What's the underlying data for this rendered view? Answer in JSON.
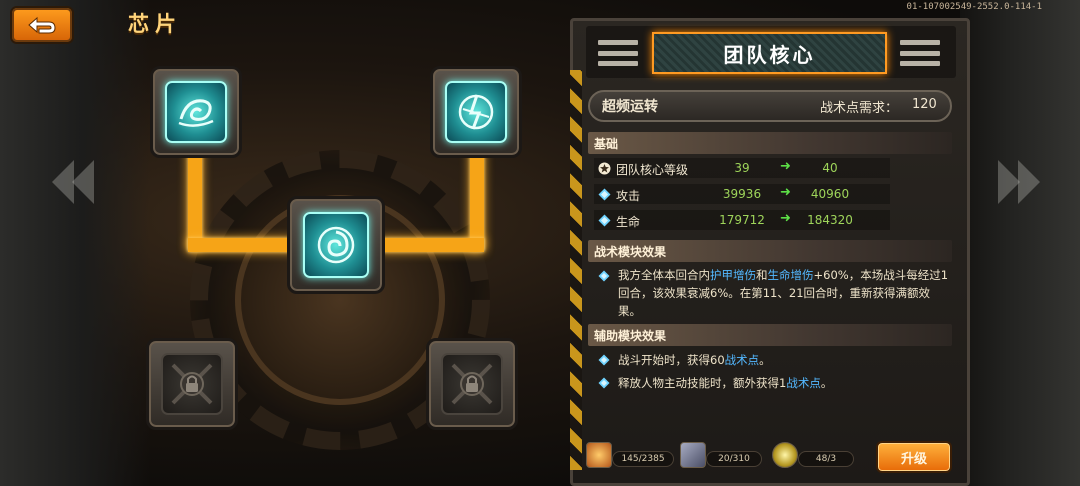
{
  "top_bar": {
    "title": "芯片",
    "build_id": "01-107002549-2552.0-114-1",
    "back_icon": "back-arrow-icon"
  },
  "chip_tree": {
    "top_left": {
      "state": "active",
      "icon": "swirl-emblem-icon"
    },
    "top_right": {
      "state": "active",
      "icon": "lightning-figure-icon"
    },
    "center": {
      "state": "active",
      "icon": "vortex-core-icon"
    },
    "bottom_left": {
      "state": "locked",
      "icon": "lock-icon"
    },
    "bottom_right": {
      "state": "locked",
      "icon": "lock-icon"
    },
    "wire_color": "#f6a417"
  },
  "panel": {
    "title": "团队核心",
    "skill": {
      "name": "超频运转",
      "cost_label": "战术点需求：",
      "cost": "120"
    },
    "basic_section": {
      "heading": "基础",
      "stats": [
        {
          "icon": "star-icon",
          "label": "团队核心等级",
          "old": "39",
          "new": "40"
        },
        {
          "icon": "diamond-icon",
          "label": "攻击",
          "old": "39936",
          "new": "40960"
        },
        {
          "icon": "diamond-icon",
          "label": "生命",
          "old": "179712",
          "new": "184320"
        }
      ]
    },
    "tactical_section": {
      "heading": "战术模块效果",
      "text_before": "我方全体本回合内",
      "hl1": "护甲增伤",
      "mid": "和",
      "hl2": "生命增伤",
      "text_after": "+60%，本场战斗每经过1回合，该效果衰减6%。在第11、21回合时，重新获得满额效果。"
    },
    "auxiliary_section": {
      "heading": "辅助模块效果",
      "effects": [
        {
          "before": "战斗开始时，获得60",
          "hl": "战术点",
          "after": "。"
        },
        {
          "before": "释放人物主动技能时，额外获得1",
          "hl": "战术点",
          "after": "。"
        }
      ]
    }
  },
  "resources": [
    {
      "icon": "chip-material-icon",
      "value": "145/2385"
    },
    {
      "icon": "data-card-icon",
      "value": "20/310"
    },
    {
      "icon": "core-gem-icon",
      "value": "48/3"
    }
  ],
  "upgrade_button": "升级",
  "colors": {
    "accent_orange": "#ff9a22",
    "value_green": "#9ed45a",
    "highlight_blue": "#53b8ff"
  }
}
